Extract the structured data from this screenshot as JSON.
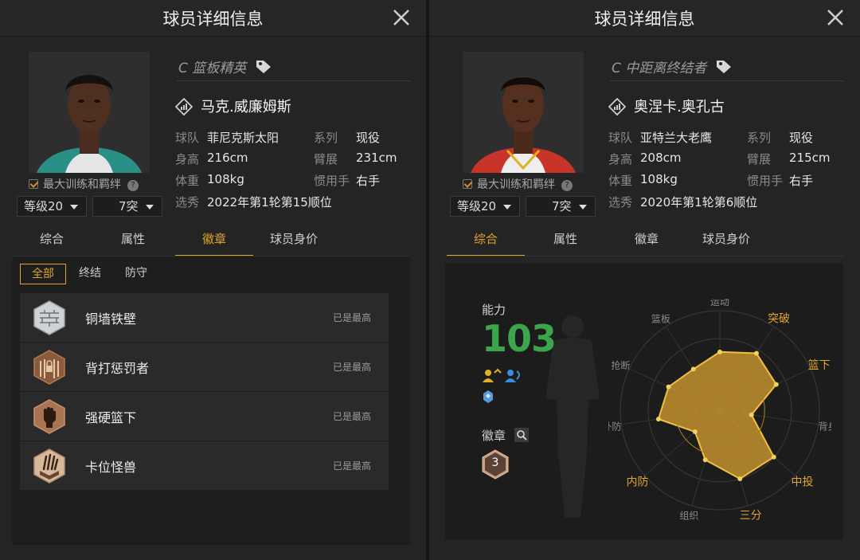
{
  "left": {
    "title": "球员详细信息",
    "role": "C 篮板精英",
    "name": "马克.威廉姆斯",
    "train_label": "最大训练和羁绊",
    "level_select": "等级20",
    "breakthrough_select": "7突",
    "info": [
      {
        "label": "球队",
        "value": "菲尼克斯太阳"
      },
      {
        "label": "系列",
        "value": "现役"
      },
      {
        "label": "身高",
        "value": "216cm"
      },
      {
        "label": "臂展",
        "value": "231cm"
      },
      {
        "label": "体重",
        "value": "108kg"
      },
      {
        "label": "惯用手",
        "value": "右手"
      },
      {
        "label": "选秀",
        "value": "2022年第1轮第15顺位"
      }
    ],
    "tabs": [
      "综合",
      "属性",
      "徽章",
      "球员身价"
    ],
    "active_tab": "徽章",
    "subtabs": [
      "全部",
      "终结",
      "防守"
    ],
    "badges": [
      {
        "name": "铜墙铁壁",
        "status": "已是最高",
        "icon": "brick-wall-icon"
      },
      {
        "name": "背打惩罚者",
        "status": "已是最高",
        "icon": "post-lock-icon"
      },
      {
        "name": "强硬篮下",
        "status": "已是最高",
        "icon": "fist-icon"
      },
      {
        "name": "卡位怪兽",
        "status": "已是最高",
        "icon": "monster-claw-icon"
      }
    ]
  },
  "right": {
    "title": "球员详细信息",
    "role": "C 中距离终结者",
    "name": "奥涅卡.奥孔古",
    "train_label": "最大训练和羁绊",
    "level_select": "等级20",
    "breakthrough_select": "7突",
    "info": [
      {
        "label": "球队",
        "value": "亚特兰大老鹰"
      },
      {
        "label": "系列",
        "value": "现役"
      },
      {
        "label": "身高",
        "value": "208cm"
      },
      {
        "label": "臂展",
        "value": "215cm"
      },
      {
        "label": "体重",
        "value": "108kg"
      },
      {
        "label": "惯用手",
        "value": "右手"
      },
      {
        "label": "选秀",
        "value": "2020年第1轮第6顺位"
      }
    ],
    "tabs": [
      "综合",
      "属性",
      "徽章",
      "球员身价"
    ],
    "active_tab": "综合",
    "ability_label": "能力",
    "ability_value": "103",
    "badges_label": "徽章",
    "badge_count": "3",
    "chart_data": {
      "type": "radar",
      "axes": [
        "运动",
        "突破",
        "篮下",
        "背身",
        "中投",
        "三分",
        "组织",
        "内防",
        "外防",
        "抢断",
        "篮板"
      ],
      "highlighted": [
        "突破",
        "篮下",
        "中投",
        "三分",
        "内防"
      ],
      "values": [
        0.62,
        0.72,
        0.66,
        0.34,
        0.76,
        0.76,
        0.55,
        0.35,
        0.66,
        0.6,
        0.52
      ],
      "colors": {
        "fill": "#c9952e",
        "stroke": "#f0c040",
        "highlight": "#e0a52a",
        "normal": "#8a8a8a"
      }
    }
  }
}
